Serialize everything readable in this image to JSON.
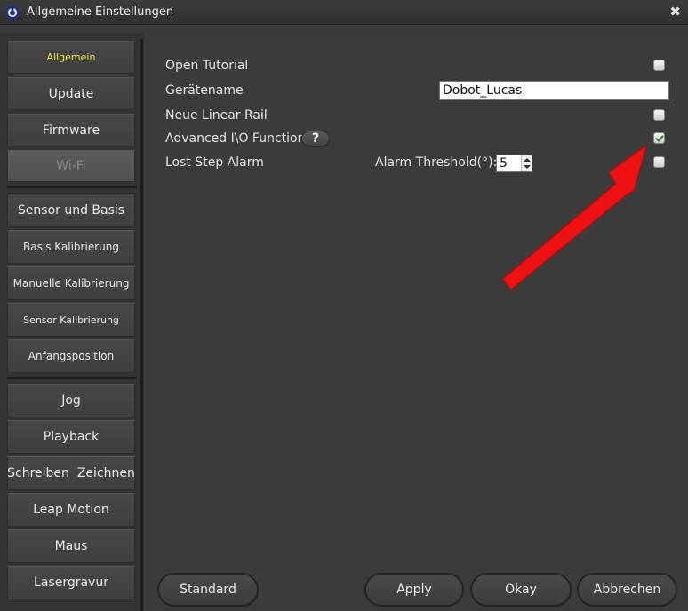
{
  "window": {
    "title": "Allgemeine Einstellungen",
    "close_glyph": "✖"
  },
  "sidebar": {
    "group1": [
      {
        "label": "Allgemein",
        "state": "active"
      },
      {
        "label": "Update",
        "state": "normal"
      },
      {
        "label": "Firmware",
        "state": "normal"
      },
      {
        "label": "Wi-Fi",
        "state": "disabled"
      }
    ],
    "group2": [
      {
        "label": "Sensor und Basis"
      },
      {
        "label": "Basis Kalibrierung"
      },
      {
        "label": "Manuelle Kalibrierung"
      },
      {
        "label": "Sensor Kalibrierung"
      },
      {
        "label": "Anfangsposition"
      }
    ],
    "group3": [
      {
        "label": "Jog"
      },
      {
        "label": "Playback"
      },
      {
        "label": "Schreiben  Zeichnen"
      },
      {
        "label": "Leap Motion"
      },
      {
        "label": "Maus"
      },
      {
        "label": "Lasergravur"
      }
    ]
  },
  "settings": {
    "open_tutorial": {
      "label": "Open Tutorial",
      "checked": false
    },
    "device_name": {
      "label": "Gerätename",
      "value": "Dobot_Lucas"
    },
    "linear_rail": {
      "label": "Neue Linear Rail",
      "checked": false
    },
    "advanced_io": {
      "label": "Advanced I\\O Function",
      "help_glyph": "?",
      "checked": true
    },
    "lost_step": {
      "label": "Lost Step Alarm",
      "threshold_label": "Alarm Threshold(°):",
      "threshold_value": "5",
      "checked": false
    }
  },
  "footer": {
    "standard": "Standard",
    "apply": "Apply",
    "okay": "Okay",
    "cancel": "Abbrechen"
  },
  "colors": {
    "active_nav": "#f0e040",
    "annotation_arrow": "#ee1111",
    "check_mark": "#2a8a2a"
  }
}
